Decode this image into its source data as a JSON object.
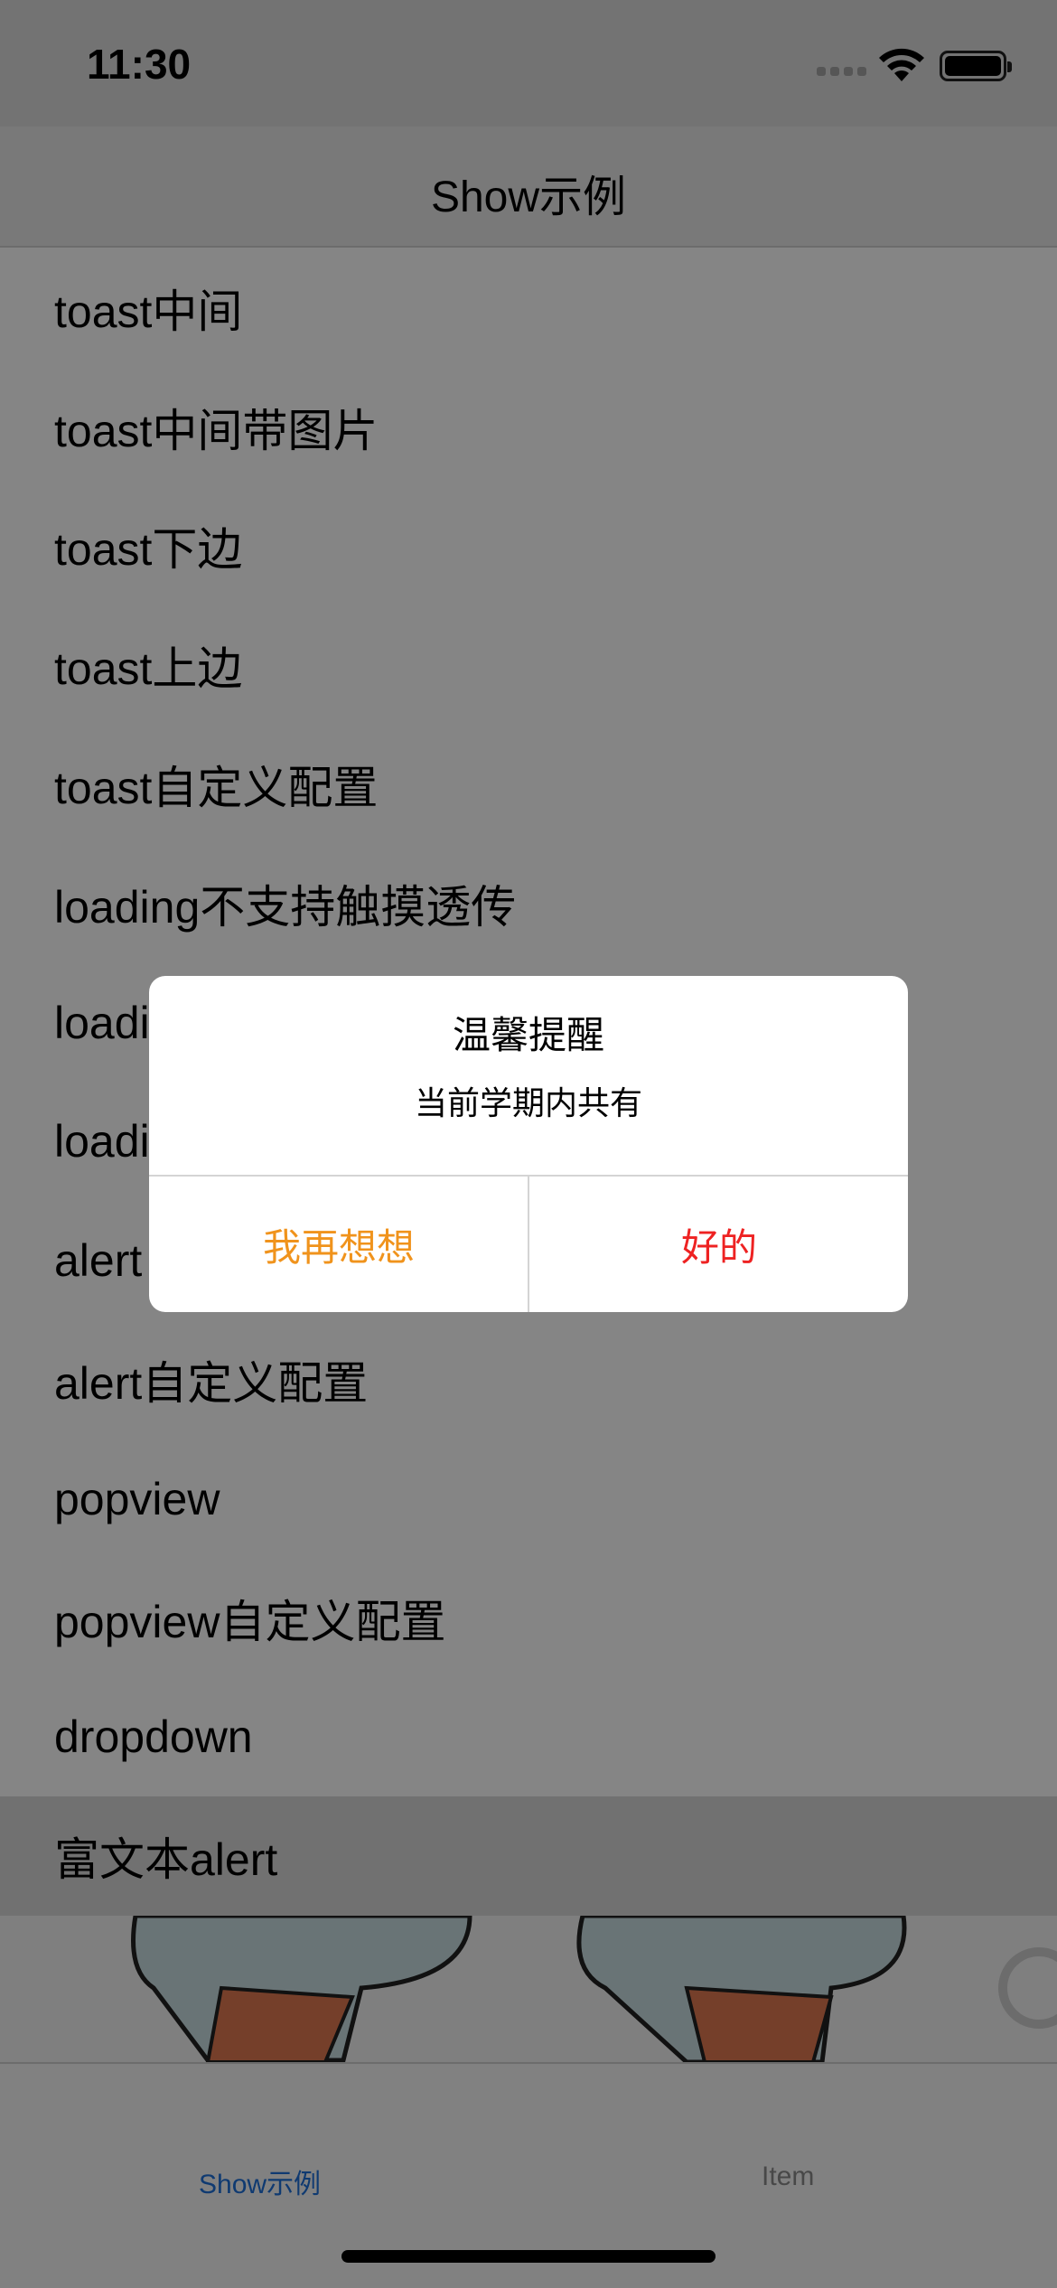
{
  "status_bar": {
    "time": "11:30"
  },
  "nav": {
    "title": "Show示例"
  },
  "list": {
    "items": [
      "toast中间",
      "toast中间带图片",
      "toast下边",
      "toast上边",
      "toast自定义配置",
      "loading不支持触摸透传",
      "loading",
      "loading",
      "alert",
      "alert自定义配置",
      "popview",
      "popview自定义配置",
      "dropdown",
      "富文本alert"
    ],
    "selected_index": 13
  },
  "tabbar": {
    "tabs": [
      {
        "label": "Show示例",
        "active": true
      },
      {
        "label": "Item",
        "active": false
      }
    ],
    "active_color": "#1e6fd9",
    "inactive_color": "#8a8a8a"
  },
  "alert": {
    "title": "温馨提醒",
    "message": "当前学期内共有",
    "cancel_label": "我再想想",
    "confirm_label": "好的",
    "cancel_color": "#f0931c",
    "confirm_color": "#ee2222"
  }
}
